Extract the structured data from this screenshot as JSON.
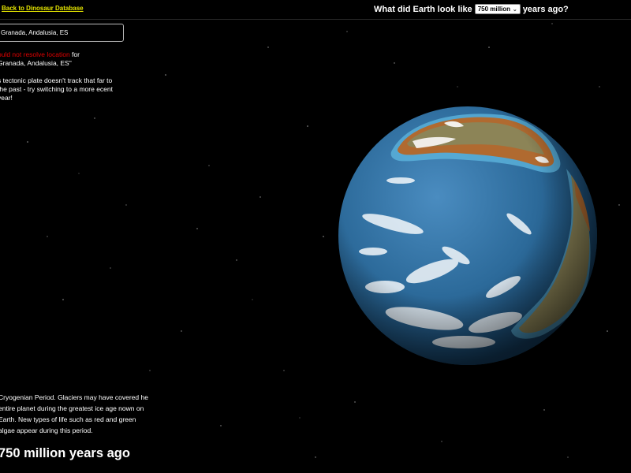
{
  "header": {
    "back_link_label": "Back to Dinosaur Database",
    "question_prefix": "What did Earth look like",
    "question_suffix": "years ago?",
    "year_select": {
      "selected": "750 million"
    }
  },
  "sidebar": {
    "location_value": "Granada, Andalusia, ES",
    "error": {
      "highlight": "ould not resolve location",
      "rest_line1": " for",
      "line2": "Granada, Andalusia, ES\""
    },
    "plate_message": "s tectonic plate doesn't track that far to the past - try switching to a more ecent year!",
    "period_description": "Cryogenian Period. Glaciers may have covered he entire planet during the greatest ice age nown on Earth. New types of life such as red and green algae appear during this period.",
    "age_heading": "750 million years ago"
  },
  "colors": {
    "background": "#000000",
    "link": "#e8e800",
    "error": "#e00000",
    "ocean": "#2f6f9f",
    "land": "#8a7a55"
  },
  "icons": {
    "select_chevron": "chevron-down-icon"
  }
}
